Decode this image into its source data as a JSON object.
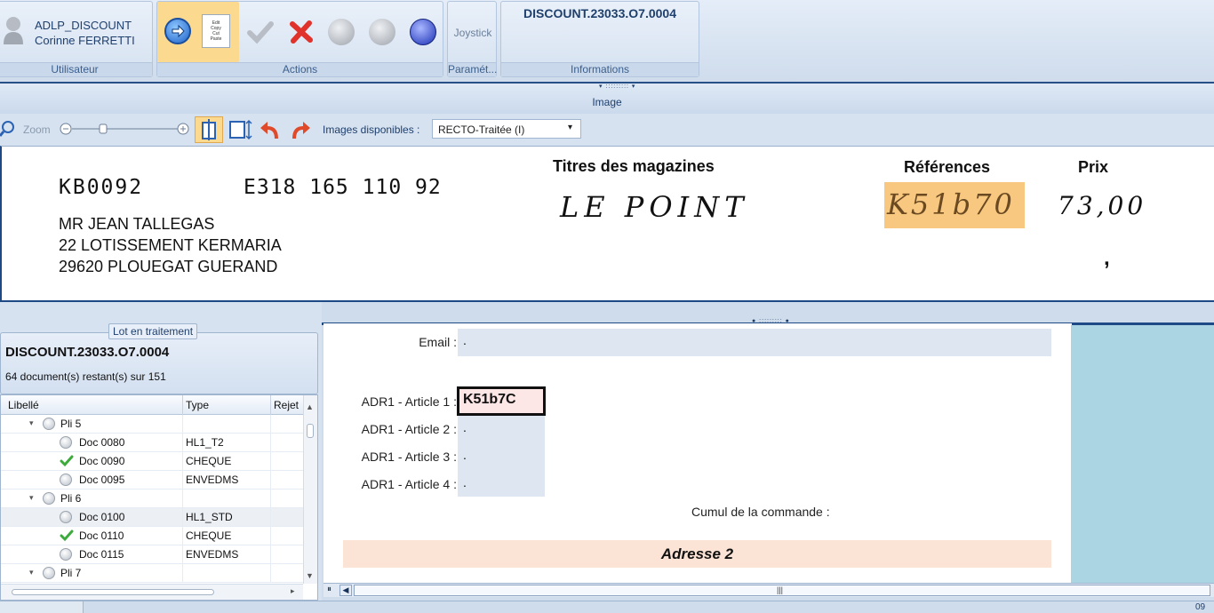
{
  "ribbon": {
    "user": {
      "login": "ADLP_DISCOUNT",
      "name": "Corinne FERRETTI",
      "caption": "Utilisateur"
    },
    "actions": {
      "caption": "Actions",
      "copy_lines": [
        "Edit",
        "Copy",
        "Cut",
        "Paste"
      ]
    },
    "params": {
      "joystick": "Joystick",
      "caption": "Paramét..."
    },
    "info": {
      "lot": "DISCOUNT.23033.O7.0004",
      "caption": "Informations"
    }
  },
  "image_panel": {
    "title": "Image",
    "zoom_label": "Zoom",
    "images_label": "Images disponibles :",
    "images_selected": "RECTO-Traitée (I)"
  },
  "document": {
    "code": "KB0092",
    "number": "E318 165 110 92",
    "address": [
      "MR JEAN TALLEGAS",
      "22 LOTISSEMENT KERMARIA",
      "29620 PLOUEGAT GUERAND"
    ],
    "col_titles": "Titres des magazines",
    "col_refs": "Références",
    "col_price": "Prix",
    "hand_title": "LE POINT",
    "hand_ref": "K51b70",
    "hand_price": "73,00",
    "hand_comma": ","
  },
  "lot": {
    "tab": "Lot en traitement",
    "name": "DISCOUNT.23033.O7.0004",
    "remaining": "64 document(s) restant(s) sur 151",
    "headers": [
      "Libellé",
      "Type",
      "Rejet"
    ],
    "rows": [
      {
        "label": "Pli 5",
        "type": "",
        "status": "group"
      },
      {
        "label": "Doc 0080",
        "type": "HL1_T2",
        "status": "pending"
      },
      {
        "label": "Doc 0090",
        "type": "CHEQUE",
        "status": "done"
      },
      {
        "label": "Doc 0095",
        "type": "ENVEDMS",
        "status": "pending"
      },
      {
        "label": "Pli 6",
        "type": "",
        "status": "group"
      },
      {
        "label": "Doc 0100",
        "type": "HL1_STD",
        "status": "pending"
      },
      {
        "label": "Doc 0110",
        "type": "CHEQUE",
        "status": "done"
      },
      {
        "label": "Doc 0115",
        "type": "ENVEDMS",
        "status": "pending"
      },
      {
        "label": "Pli 7",
        "type": "",
        "status": "group"
      }
    ]
  },
  "form": {
    "email_label": "Email :",
    "email_value": ".",
    "art1_label": "ADR1 - Article 1 :",
    "art1_value": "K51b7C",
    "art2_label": "ADR1 - Article 2 :",
    "art2_value": ".",
    "art3_label": "ADR1 - Article 3 :",
    "art3_value": ".",
    "art4_label": "ADR1 - Article 4 :",
    "art4_value": ".",
    "cumul_label": "Cumul de la commande :",
    "section2": "Adresse 2"
  },
  "status": {
    "right": "09"
  },
  "colors": {
    "accent": "#1d4a86",
    "highlight": "#f8c880",
    "field": "#dde6f1",
    "section": "#fbe3d6",
    "side": "#abd5e2"
  }
}
